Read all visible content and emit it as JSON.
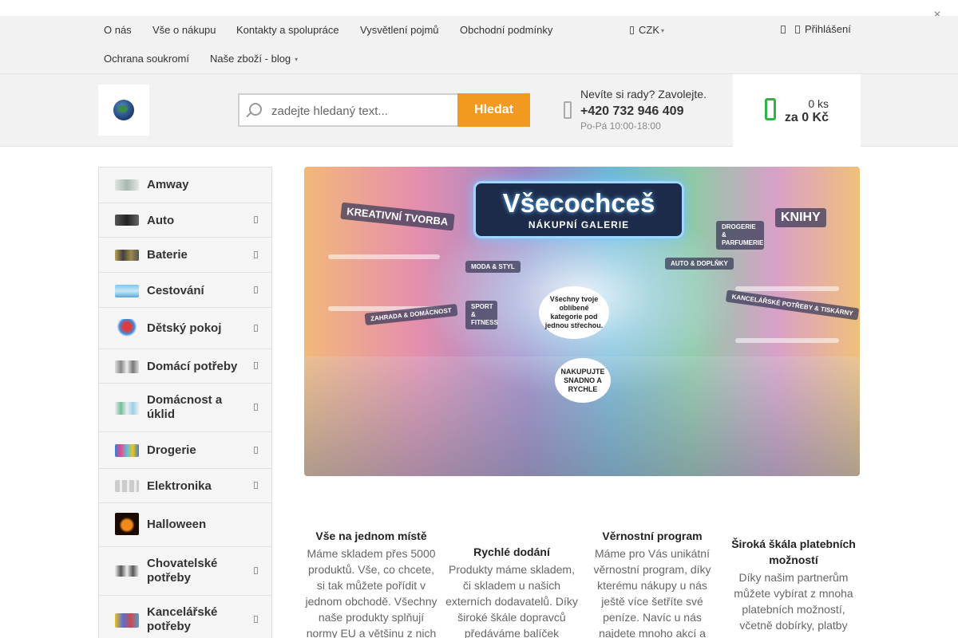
{
  "nav": {
    "links_row1": [
      "O nás",
      "Vše o nákupu",
      "Kontakty a spolupráce",
      "Vysvětlení pojmů",
      "Obchodní podmínky"
    ],
    "links_row2": [
      "Ochrana soukromí",
      "Naše zboží - blog"
    ],
    "currency": "CZK",
    "login": "Přihlášení"
  },
  "search": {
    "placeholder": "zadejte hledaný text...",
    "button": "Hledat"
  },
  "contact": {
    "question": "Nevíte si rady? Zavolejte.",
    "phone": "+420 732 946 409",
    "hours": "Po-Pá 10:00-18:00"
  },
  "cart": {
    "count": "0 ks",
    "total": "za 0 Kč"
  },
  "categories": [
    {
      "label": "Amway"
    },
    {
      "label": "Auto"
    },
    {
      "label": "Baterie"
    },
    {
      "label": "Cestování"
    },
    {
      "label": "Dětský pokoj"
    },
    {
      "label": "Domácí potřeby"
    },
    {
      "label": "Domácnost a úklid"
    },
    {
      "label": "Drogerie"
    },
    {
      "label": "Elektronika"
    },
    {
      "label": "Halloween"
    },
    {
      "label": "Chovatelské potřeby"
    },
    {
      "label": "Kancelářské potřeby"
    }
  ],
  "hero": {
    "title": "Všecochceš",
    "subtitle": "NÁKUPNÍ GALERIE",
    "sign_kreativni": "KREATIVNÍ TVORBA",
    "sign_knihy": "KNIHY",
    "sign_drogerie": "DROGERIE & PARFUMERIE",
    "sign_moda": "MODA & STYL",
    "sign_auto": "AUTO & DOPLŇKY",
    "sign_sport": "SPORT & FITNESS",
    "sign_zahrada": "ZAHRADA & DOMÁCNOST",
    "sign_kancelar": "KANCELÁŘSKÉ POTŘEBY & TISKÁRNY",
    "bubble_kategorie": "Všechny tvoje oblíbené kategorie pod jednou střechou.",
    "bubble_nakupujte": "NAKUPUJTE SNADNO A RYCHLE"
  },
  "features": [
    {
      "title": "Vše na jednom místě",
      "text": "Máme skladem přes 5000 produktů. Vše, co chcete, si tak můžete pořídit v jednom obchodě. Všechny naše produkty splňují normy EU a většinu z nich"
    },
    {
      "title": "Rychlé dodání",
      "text": "Produkty máme skladem, či skladem u našich externích dodavatelů. Díky široké škále dopravců předáváme balíček"
    },
    {
      "title": "Věrnostní program",
      "text": "Máme pro Vás unikátní věrnostní program, díky kterému nákupy u nás ještě více šetříte své peníze. Navíc u nás najdete mnoho akcí a"
    },
    {
      "title": "Široká škála platebních možností",
      "text": "Díky našim partnerům můžete vybírat z mnoha platebních možností, včetně dobírky, platby"
    }
  ]
}
